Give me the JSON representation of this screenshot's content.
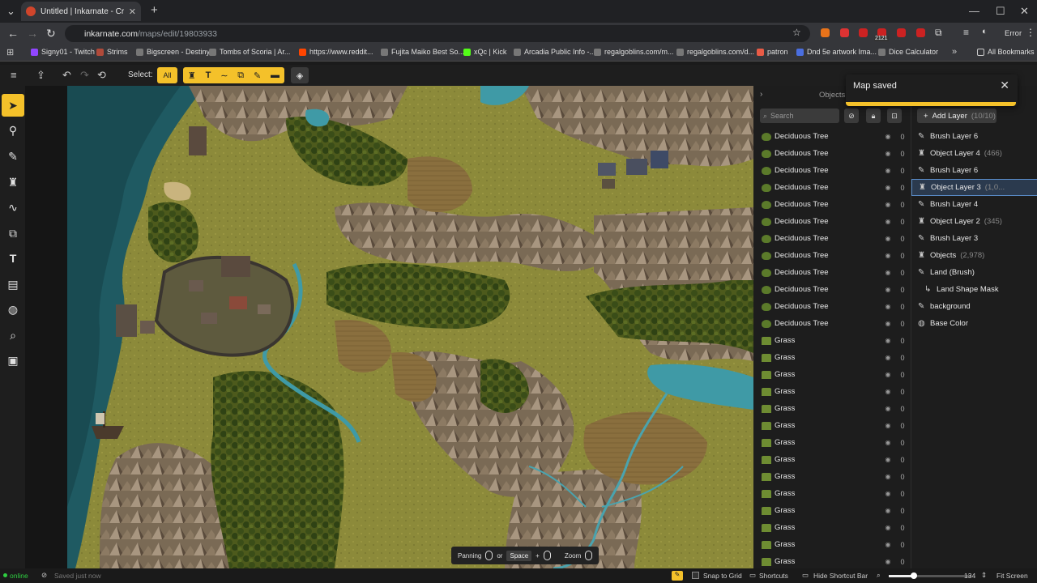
{
  "browser": {
    "tab_title": "Untitled | Inkarnate - Create Fa",
    "url_host": "inkarnate.com",
    "url_path": "/maps/edit/19803933",
    "profile_label": "Error",
    "ext_badge": "2121"
  },
  "bookmarks": [
    {
      "label": "Signy01 - Twitch",
      "color": "#9146ff"
    },
    {
      "label": "Strims",
      "color": "#b04a3a"
    },
    {
      "label": "Bigscreen - Destiny...",
      "color": "#777"
    },
    {
      "label": "Tombs of Scoria | Ar...",
      "color": "#777"
    },
    {
      "label": "https://www.reddit...",
      "color": "#ff4500"
    },
    {
      "label": "Fujita Maiko Best So...",
      "color": "#777"
    },
    {
      "label": "xQc | Kick",
      "color": "#53fc18"
    },
    {
      "label": "Arcadia Public Info -...",
      "color": "#777"
    },
    {
      "label": "regalgoblins.com/m...",
      "color": "#777"
    },
    {
      "label": "regalgoblins.com/d...",
      "color": "#777"
    },
    {
      "label": "patron",
      "color": "#e85b46"
    },
    {
      "label": "Dnd 5e artwork Ima...",
      "color": "#4a6ee0"
    },
    {
      "label": "Dice Calculator",
      "color": "#777"
    }
  ],
  "all_bookmarks_label": "All Bookmarks",
  "toolbar": {
    "select_label": "Select:",
    "all_label": "All"
  },
  "objects_panel": {
    "header": "Objects",
    "search_placeholder": "Search",
    "rows": [
      {
        "name": "Deciduous Tree",
        "count": "0",
        "kind": "tree"
      },
      {
        "name": "Deciduous Tree",
        "count": "0",
        "kind": "tree"
      },
      {
        "name": "Deciduous Tree",
        "count": "0",
        "kind": "tree"
      },
      {
        "name": "Deciduous Tree",
        "count": "0",
        "kind": "tree"
      },
      {
        "name": "Deciduous Tree",
        "count": "0",
        "kind": "tree"
      },
      {
        "name": "Deciduous Tree",
        "count": "0",
        "kind": "tree"
      },
      {
        "name": "Deciduous Tree",
        "count": "0",
        "kind": "tree"
      },
      {
        "name": "Deciduous Tree",
        "count": "0",
        "kind": "tree"
      },
      {
        "name": "Deciduous Tree",
        "count": "0",
        "kind": "tree"
      },
      {
        "name": "Deciduous Tree",
        "count": "0",
        "kind": "tree"
      },
      {
        "name": "Deciduous Tree",
        "count": "0",
        "kind": "tree"
      },
      {
        "name": "Deciduous Tree",
        "count": "0",
        "kind": "tree"
      },
      {
        "name": "Grass",
        "count": "0",
        "kind": "grass"
      },
      {
        "name": "Grass",
        "count": "0",
        "kind": "grass"
      },
      {
        "name": "Grass",
        "count": "0",
        "kind": "grass"
      },
      {
        "name": "Grass",
        "count": "0",
        "kind": "grass"
      },
      {
        "name": "Grass",
        "count": "0",
        "kind": "grass"
      },
      {
        "name": "Grass",
        "count": "0",
        "kind": "grass"
      },
      {
        "name": "Grass",
        "count": "0",
        "kind": "grass"
      },
      {
        "name": "Grass",
        "count": "0",
        "kind": "grass"
      },
      {
        "name": "Grass",
        "count": "0",
        "kind": "grass"
      },
      {
        "name": "Grass",
        "count": "0",
        "kind": "grass"
      },
      {
        "name": "Grass",
        "count": "0",
        "kind": "grass"
      },
      {
        "name": "Grass",
        "count": "0",
        "kind": "grass"
      },
      {
        "name": "Grass",
        "count": "0",
        "kind": "grass"
      },
      {
        "name": "Grass",
        "count": "0",
        "kind": "grass"
      }
    ]
  },
  "layers_panel": {
    "add_label": "Add Layer",
    "add_count": "(10/10)",
    "layers": [
      {
        "name": "Brush Layer 6",
        "sub": "",
        "icon": "brush",
        "selected": false
      },
      {
        "name": "Object Layer 4",
        "sub": "(466)",
        "icon": "object",
        "selected": false
      },
      {
        "name": "Brush Layer 6",
        "sub": "",
        "icon": "brush",
        "selected": false
      },
      {
        "name": "Object Layer 3",
        "sub": "(1,0...",
        "icon": "object",
        "selected": true
      },
      {
        "name": "Brush Layer 4",
        "sub": "",
        "icon": "brush",
        "selected": false
      },
      {
        "name": "Object Layer 2",
        "sub": "(345)",
        "icon": "object",
        "selected": false
      },
      {
        "name": "Brush Layer 3",
        "sub": "",
        "icon": "brush",
        "selected": false
      },
      {
        "name": "Objects",
        "sub": "(2,978)",
        "icon": "object",
        "selected": false
      },
      {
        "name": "Land (Brush)",
        "sub": "",
        "icon": "brush",
        "selected": false
      },
      {
        "name": "Land Shape Mask",
        "sub": "",
        "icon": "mask",
        "selected": false
      },
      {
        "name": "background",
        "sub": "",
        "icon": "brush",
        "selected": false
      },
      {
        "name": "Base Color",
        "sub": "",
        "icon": "color",
        "selected": false
      }
    ]
  },
  "toast": {
    "message": "Map saved"
  },
  "shortcut_bar": {
    "panning": "Panning",
    "or": "or",
    "space": "Space",
    "plus": "+",
    "zoom": "Zoom"
  },
  "status": {
    "online": "online",
    "saved": "Saved just now",
    "snap": "Snap to Grid",
    "shortcuts": "Shortcuts",
    "hide_bar": "Hide Shortcut Bar",
    "zoom_value": "134",
    "zoom_fraction": 0.3,
    "fit": "Fit Screen"
  },
  "colors": {
    "accent": "#f4c12a",
    "selection": "#5a8cc8",
    "online": "#2ecc40"
  }
}
